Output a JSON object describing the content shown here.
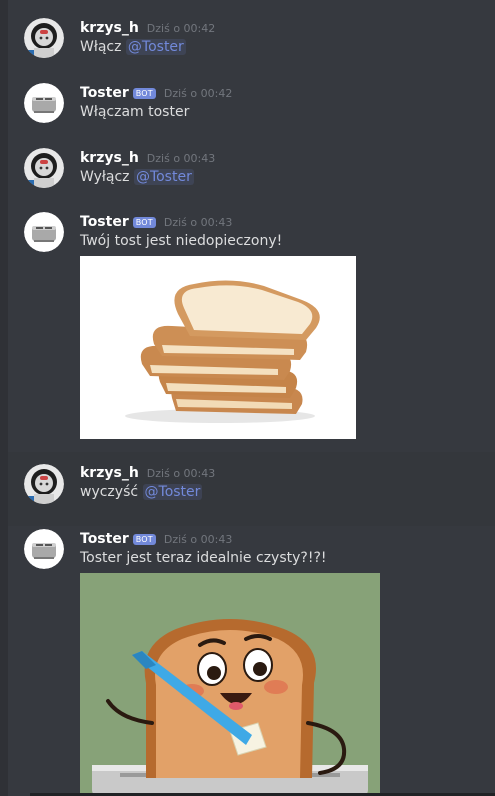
{
  "messages": [
    {
      "author": "krzys_h",
      "is_bot": false,
      "timestamp": "Dziś o 00:42",
      "text": "Włącz ",
      "mention": "@Toster",
      "avatar": "astronaut-avatar"
    },
    {
      "author": "Toster",
      "is_bot": true,
      "bot_tag": "BOT",
      "timestamp": "Dziś o 00:42",
      "text": "Włączam toster",
      "avatar": "toaster-avatar"
    },
    {
      "author": "krzys_h",
      "is_bot": false,
      "timestamp": "Dziś o 00:43",
      "text": "Wyłącz ",
      "mention": "@Toster",
      "avatar": "astronaut-avatar"
    },
    {
      "author": "Toster",
      "is_bot": true,
      "bot_tag": "BOT",
      "timestamp": "Dziś o 00:43",
      "text": "Twój tost jest niedopieczony!",
      "avatar": "toaster-avatar",
      "attachment": "bread-slices-image"
    },
    {
      "author": "krzys_h",
      "is_bot": false,
      "timestamp": "Dziś o 00:43",
      "text": "wyczyść ",
      "mention": "@Toster",
      "avatar": "astronaut-avatar"
    },
    {
      "author": "Toster",
      "is_bot": true,
      "bot_tag": "BOT",
      "timestamp": "Dziś o 00:43",
      "text": "Toster jest teraz idealnie czysty?!?!",
      "avatar": "toaster-avatar",
      "attachment": "cartoon-toast-image"
    }
  ],
  "colors": {
    "background": "#36393f",
    "highlight": "#34373c",
    "mention": "#7289da",
    "bot_tag": "#7289da",
    "username": "#ffffff",
    "text": "#dcddde",
    "timestamp": "#72767d"
  }
}
